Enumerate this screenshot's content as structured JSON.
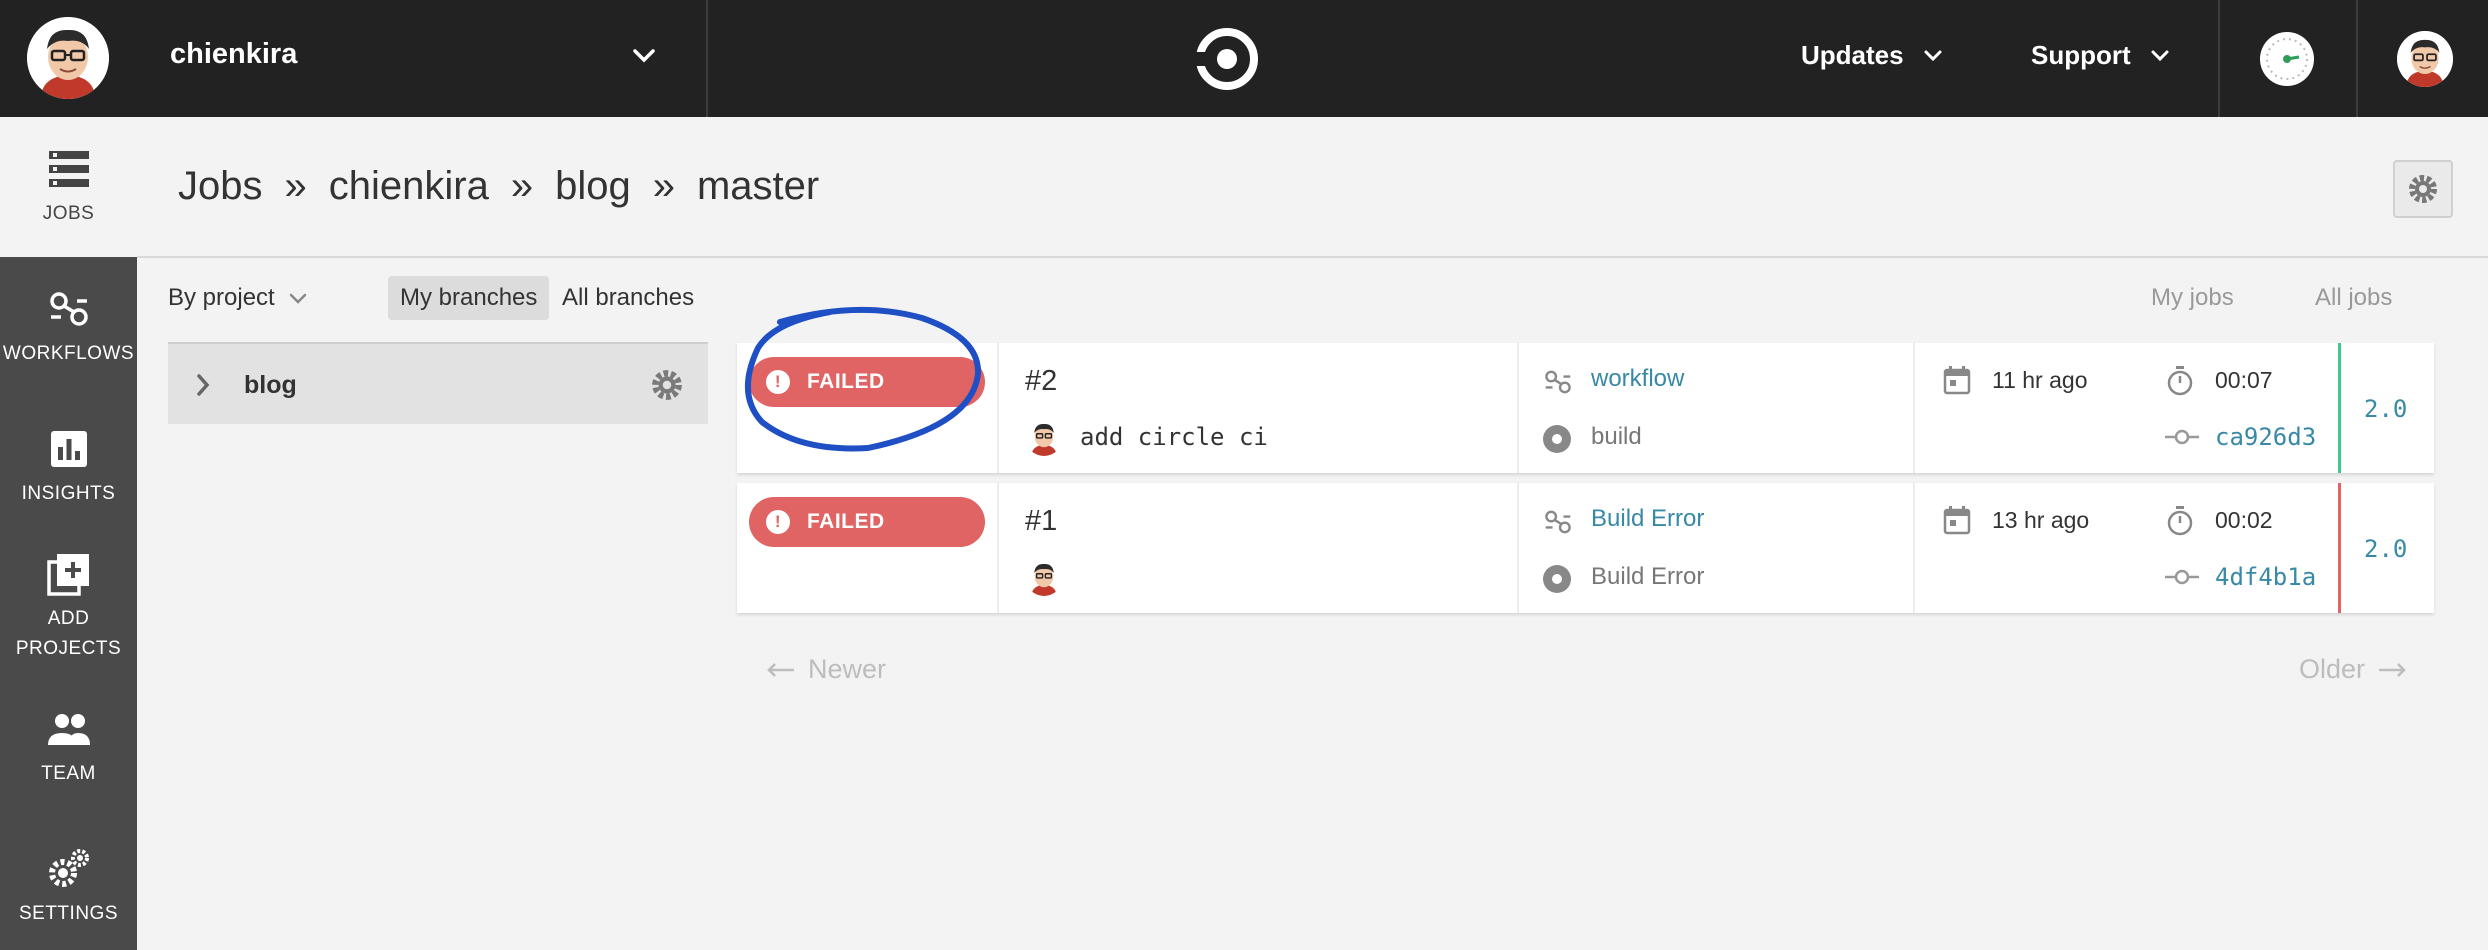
{
  "topbar": {
    "org_name": "chienkira",
    "nav": [
      {
        "label": "Updates"
      },
      {
        "label": "Support"
      }
    ]
  },
  "sidebar": {
    "items": [
      {
        "label": "JOBS",
        "icon": "jobs-icon",
        "active": true
      },
      {
        "label": "WORKFLOWS",
        "icon": "workflows-icon"
      },
      {
        "label": "INSIGHTS",
        "icon": "insights-icon"
      },
      {
        "label": "ADD PROJECTS",
        "icon": "add-projects-icon"
      },
      {
        "label": "TEAM",
        "icon": "team-icon"
      },
      {
        "label": "SETTINGS",
        "icon": "settings-icon"
      }
    ]
  },
  "breadcrumb": [
    "Jobs",
    "chienkira",
    "blog",
    "master"
  ],
  "breadcrumb_separator": "»",
  "filters": {
    "by_project": "By project",
    "my_branches": "My branches",
    "all_branches": "All branches",
    "my_jobs": "My jobs",
    "all_jobs": "All jobs"
  },
  "projects": [
    {
      "name": "blog"
    }
  ],
  "jobs": [
    {
      "status": "FAILED",
      "number": "#2",
      "commit_message": "add circle ci",
      "workflow": "workflow",
      "job_name": "build",
      "time_ago": "11 hr ago",
      "duration": "00:07",
      "sha": "ca926d3",
      "version": "2.0",
      "stripe_color": "#42c88a"
    },
    {
      "status": "FAILED",
      "number": "#1",
      "commit_message": "",
      "workflow": "Build Error",
      "job_name": "Build Error",
      "time_ago": "13 hr ago",
      "duration": "00:02",
      "sha": "4df4b1a",
      "version": "2.0",
      "stripe_color": "#e06463"
    }
  ],
  "pager": {
    "newer": "Newer",
    "older": "Older"
  },
  "colors": {
    "failed": "#e06463",
    "link": "#3889a6",
    "topbar": "#222222",
    "sidebar": "#4a4a4a",
    "annotation": "#1e4fc4"
  }
}
